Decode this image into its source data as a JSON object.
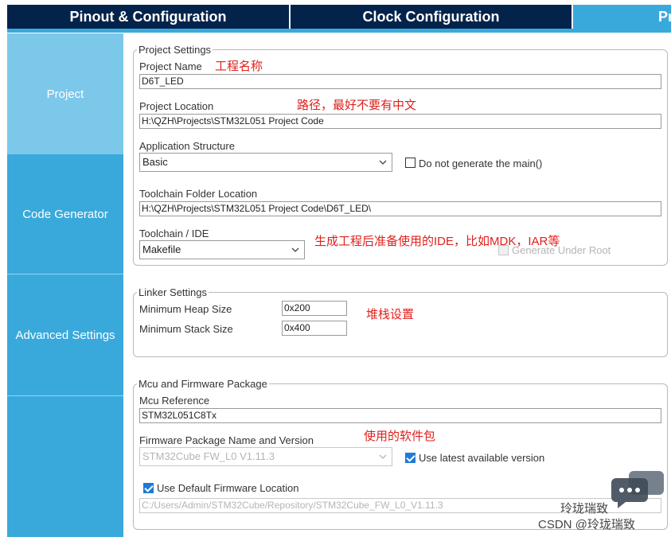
{
  "tabs": {
    "pinout": "Pinout & Configuration",
    "clock": "Clock Configuration",
    "project": "Pr",
    "colors": {
      "active": "#39a9dc",
      "inactive": "#03234b"
    }
  },
  "sidebar": {
    "items": [
      {
        "label": "Project"
      },
      {
        "label": "Code Generator"
      },
      {
        "label": "Advanced Settings"
      }
    ]
  },
  "project_settings": {
    "title": "Project Settings",
    "project_name_label": "Project Name",
    "project_name_value": "D6T_LED",
    "project_location_label": "Project Location",
    "project_location_value": "H:\\QZH\\Projects\\STM32L051 Project Code",
    "app_structure_label": "Application Structure",
    "app_structure_value": "Basic",
    "no_main_label": "Do not generate the main()",
    "no_main_checked": false,
    "toolchain_folder_label": "Toolchain Folder Location",
    "toolchain_folder_value": "H:\\QZH\\Projects\\STM32L051 Project Code\\D6T_LED\\",
    "toolchain_ide_label": "Toolchain / IDE",
    "toolchain_ide_value": "Makefile",
    "generate_under_root_label": "Generate Under Root",
    "generate_under_root_checked": false
  },
  "linker_settings": {
    "title": "Linker Settings",
    "heap_label": "Minimum Heap Size",
    "heap_value": "0x200",
    "stack_label": "Minimum Stack Size",
    "stack_value": "0x400"
  },
  "mcu_firmware": {
    "title": "Mcu and Firmware Package",
    "mcu_ref_label": "Mcu Reference",
    "mcu_ref_value": "STM32L051C8Tx",
    "fw_name_label": "Firmware Package Name and Version",
    "fw_name_value": "STM32Cube FW_L0 V1.11.3",
    "use_latest_label": "Use latest available version",
    "use_latest_checked": true,
    "use_default_label": "Use Default Firmware Location",
    "use_default_checked": true,
    "fw_location_value": "C:/Users/Admin/STM32Cube/Repository/STM32Cube_FW_L0_V1.11.3"
  },
  "annotations": {
    "project_name": "工程名称",
    "project_location": "路径，最好不要有中文",
    "toolchain": "生成工程后准备使用的IDE，比如MDK，IAR等",
    "stack": "堆栈设置",
    "firmware": "使用的软件包",
    "color": "#e0201b"
  },
  "watermark": {
    "line1": "玲珑瑞致",
    "line2": "CSDN @玲珑瑞致"
  }
}
